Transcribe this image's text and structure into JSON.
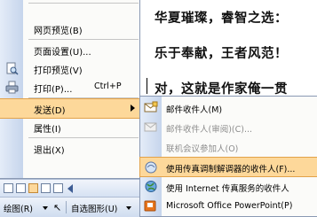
{
  "document": {
    "lines": [
      "华夏璀璨，睿智之选：",
      "乐于奉献，王者风范！",
      "对，这就是作家俺一贯"
    ]
  },
  "file_menu": {
    "items": [
      {
        "label": "网页预览(B)"
      },
      {
        "label": "页面设置(U)..."
      },
      {
        "label": "打印预览(V)"
      },
      {
        "label": "打印(P)...",
        "shortcut": "Ctrl+P"
      },
      {
        "label": "发送(D)"
      },
      {
        "label": "属性(I)"
      },
      {
        "label": "退出(X)"
      }
    ]
  },
  "send_menu": {
    "items": [
      {
        "label": "邮件收件人(M)",
        "enabled": true
      },
      {
        "label": "邮件收件人(审阅)(C)...",
        "enabled": false
      },
      {
        "label": "联机会议参加人(O)",
        "enabled": false
      },
      {
        "label": "使用传真调制解调器的收件人(F)...",
        "enabled": true,
        "highlighted": true
      },
      {
        "label": "使用 Internet 传真服务的收件人",
        "enabled": true
      },
      {
        "label": "Microsoft Office PowerPoint(P)",
        "enabled": true
      }
    ]
  },
  "toolbar": {
    "draw_label": "绘图(R)",
    "autoshape_label": "自选图形(U)"
  },
  "colors": {
    "highlight": "#fdd89a",
    "gutter": "#c6d5ec",
    "menu_bg": "#fbfbf9"
  }
}
